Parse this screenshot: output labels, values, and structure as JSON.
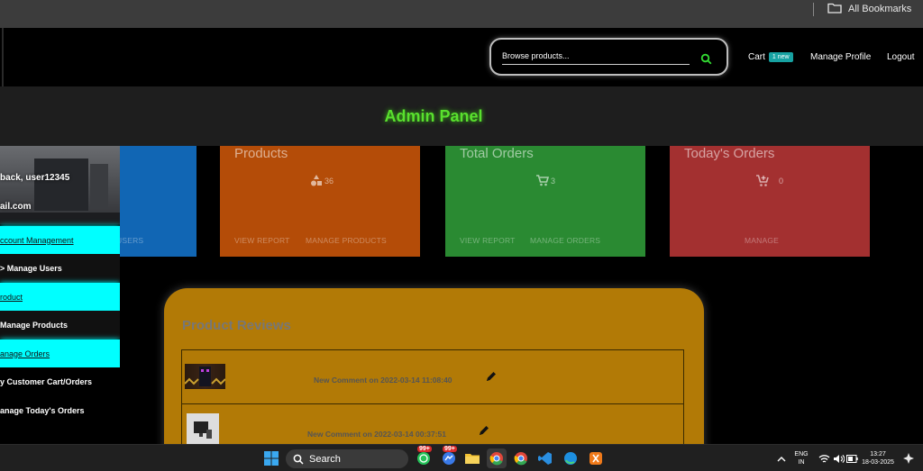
{
  "bookmarks_bar": {
    "label": "All Bookmarks"
  },
  "navbar": {
    "search_placeholder": "Browse products...",
    "cart_label": "Cart",
    "cart_badge": "1 new",
    "manage_profile": "Manage Profile",
    "logout": "Logout"
  },
  "header": {
    "title": "Admin Panel"
  },
  "sidebar": {
    "welcome": "back, user12345",
    "email": "ail.com",
    "items": [
      {
        "label": "ccount Management"
      },
      {
        "label": "> Manage Users"
      },
      {
        "label": "roduct"
      },
      {
        "label": "Manage Products"
      },
      {
        "label": "anage Orders"
      },
      {
        "label": "y Customer Cart/Orders"
      },
      {
        "label": "anage Today's Orders"
      }
    ]
  },
  "cards": {
    "users": {
      "link": "USERS"
    },
    "products": {
      "title": "Products",
      "count": "36",
      "link1": "VIEW REPORT",
      "link2": "MANAGE PRODUCTS"
    },
    "orders": {
      "title": "Total Orders",
      "count": "3",
      "link1": "VIEW REPORT",
      "link2": "MANAGE ORDERS"
    },
    "today": {
      "title": "Today's Orders",
      "count": "0",
      "link": "MANAGE"
    }
  },
  "reviews": {
    "title": "Product Reviews",
    "items": [
      {
        "text": "New Comment on 2022-03-14 11:08:40"
      },
      {
        "text": "New Comment on 2022-03-14 00:37:51"
      }
    ]
  },
  "taskbar": {
    "search": "Search",
    "badge1": "99+",
    "badge2": "99+",
    "lang": "ENG",
    "region": "IN",
    "time": "13:27",
    "date": "18-03-2025"
  },
  "colors": {
    "accent_green": "#59e02e",
    "sidebar_highlight": "#00ffff",
    "card_users": "#1166b4",
    "card_products": "#b44c08",
    "card_orders": "#2a8a32",
    "card_today": "#a33030",
    "reviews_panel": "#b27a06",
    "cart_badge": "#17a2a2"
  }
}
